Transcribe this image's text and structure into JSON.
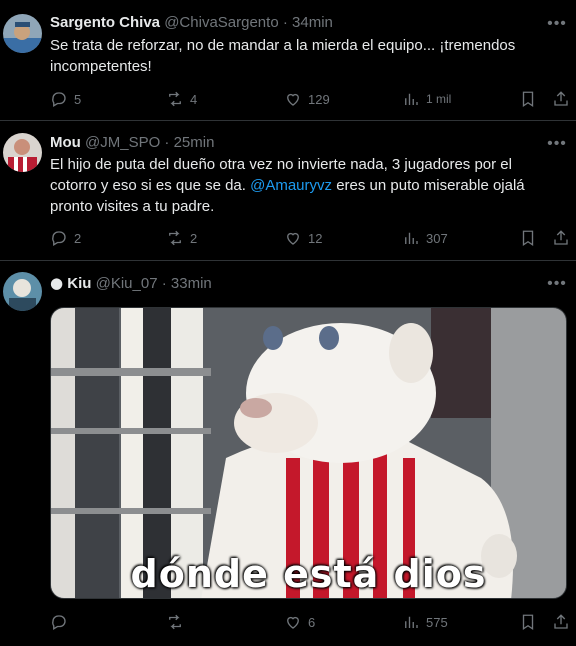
{
  "tweets": [
    {
      "display_name": "Sargento Chiva",
      "handle": "@ChivaSargento",
      "separator": "·",
      "time": "34min",
      "text": "Se trata de reforzar, no de mandar a la mierda el equipo... ¡tremendos incompetentes!",
      "replies": "5",
      "retweets": "4",
      "likes": "129",
      "views": "1 mil"
    },
    {
      "display_name": "Mou",
      "handle": "@JM_SPO",
      "separator": "·",
      "time": "25min",
      "text_before": "El hijo de puta del dueño otra vez no invierte nada, 3 jugadores por el cotorro y eso si es que se da. ",
      "mention": "@Amauryvz",
      "text_after": " eres un puto miserable ojalá pronto visites a tu padre.",
      "replies": "2",
      "retweets": "2",
      "likes": "12",
      "views": "307"
    },
    {
      "display_name": "Kiu",
      "handle": "@Kiu_07",
      "separator": "·",
      "time": "33min",
      "media_caption": "dónde está dios",
      "replies": "",
      "retweets": "",
      "likes": "6",
      "views": "575"
    }
  ],
  "icons": {
    "reply": "reply-icon",
    "retweet": "retweet-icon",
    "like": "heart-icon",
    "views": "views-icon",
    "bookmark": "bookmark-icon",
    "share": "share-icon",
    "more": "more-icon",
    "apple": "apple-icon"
  },
  "colors": {
    "background": "#000000",
    "text": "#e7e9ea",
    "secondary": "#71767b",
    "link": "#1d9bf0",
    "border": "#2f3336"
  }
}
